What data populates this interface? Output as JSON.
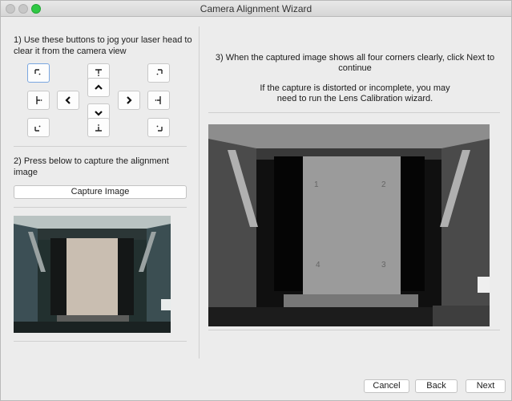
{
  "window": {
    "title": "Camera Alignment Wizard"
  },
  "step1": {
    "text": "1) Use these buttons to jog your laser head to clear it from the camera view"
  },
  "jog_buttons": [
    {
      "name": "jog-top-left-button",
      "icon": "corner-top-left-icon"
    },
    {
      "name": "jog-top-center-button",
      "icon": "edge-top-icon"
    },
    {
      "name": "jog-top-right-button",
      "icon": "corner-top-right-icon"
    },
    {
      "name": "jog-up-button",
      "icon": "chevron-up-icon"
    },
    {
      "name": "jog-middle-left-button",
      "icon": "edge-left-icon"
    },
    {
      "name": "jog-left-button",
      "icon": "chevron-left-icon"
    },
    {
      "name": "jog-right-button",
      "icon": "chevron-right-icon"
    },
    {
      "name": "jog-middle-right-button",
      "icon": "edge-right-icon"
    },
    {
      "name": "jog-down-button",
      "icon": "chevron-down-icon"
    },
    {
      "name": "jog-bottom-left-button",
      "icon": "corner-bottom-left-icon"
    },
    {
      "name": "jog-bottom-center-button",
      "icon": "edge-bottom-icon"
    },
    {
      "name": "jog-bottom-right-button",
      "icon": "corner-bottom-right-icon"
    }
  ],
  "step2": {
    "text": "2) Press below to capture the alignment image",
    "capture_label": "Capture Image"
  },
  "step3": {
    "line1": "3) When the captured image shows all four corners clearly, click Next to continue",
    "line2": "If the capture is distorted or incomplete, you may need to run the Lens Calibration wizard."
  },
  "preview": {
    "corner_labels": [
      "1",
      "2",
      "3",
      "4"
    ]
  },
  "footer": {
    "cancel_label": "Cancel",
    "back_label": "Back",
    "next_label": "Next"
  }
}
